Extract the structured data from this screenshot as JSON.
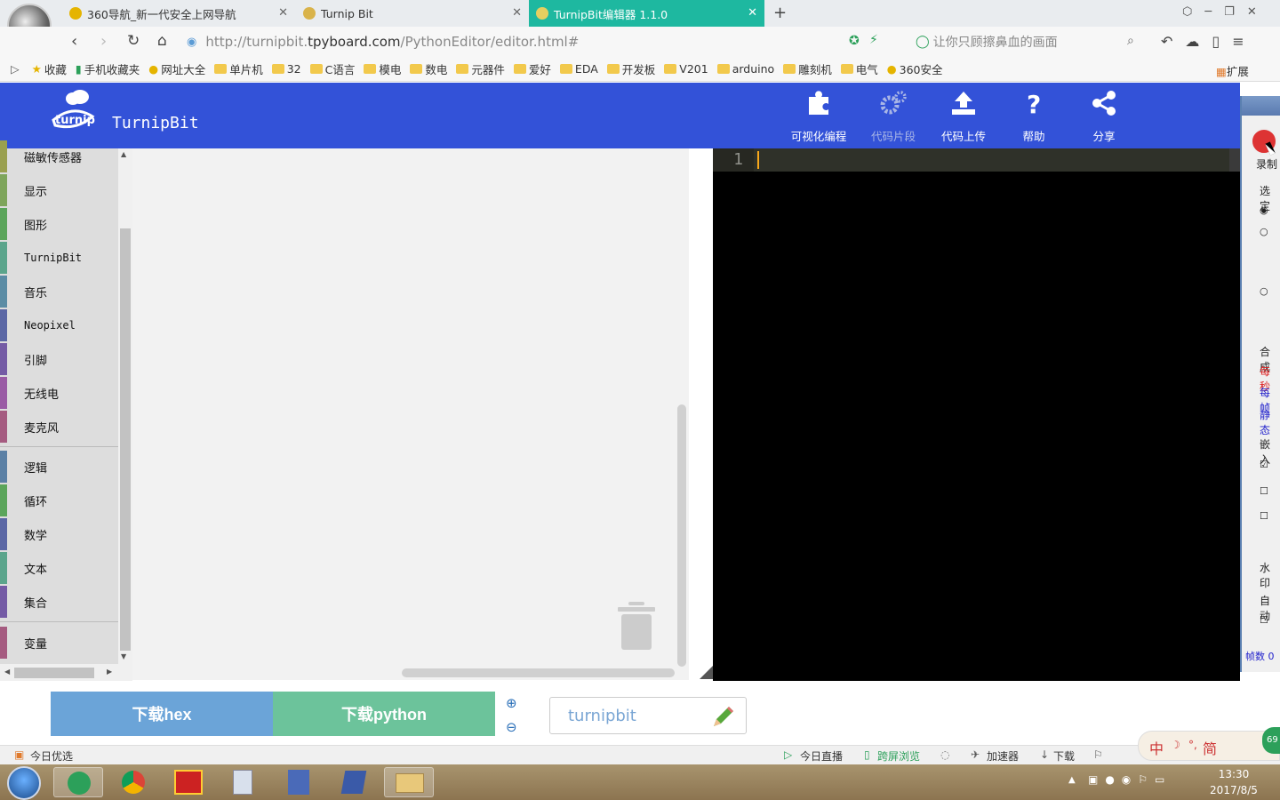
{
  "browser": {
    "tabs": [
      {
        "title": "360导航_新一代安全上网导航"
      },
      {
        "title": "Turnip Bit"
      },
      {
        "title": "TurnipBit编辑器 1.1.0"
      }
    ],
    "new_tab": "+",
    "url_prefix": "http://turnipbit.",
    "url_domain": "tpyboard.com",
    "url_path": "/PythonEditor/editor.html#",
    "search_placeholder": "让你只顾擦鼻血的画面",
    "bookmarks": [
      "收藏",
      "手机收藏夹",
      "网址大全",
      "单片机",
      "32",
      "C语言",
      "模电",
      "数电",
      "元器件",
      "爱好",
      "EDA",
      "开发板",
      "V201",
      "arduino",
      "雕刻机",
      "电气",
      "360安全"
    ],
    "extensions": "扩展"
  },
  "app": {
    "brand": "TurnipBit",
    "header_buttons": [
      {
        "label": "可视化编程",
        "icon": "puzzle-icon"
      },
      {
        "label": "代码片段",
        "icon": "gears-icon"
      },
      {
        "label": "代码上传",
        "icon": "upload-icon"
      },
      {
        "label": "帮助",
        "icon": "question-icon"
      },
      {
        "label": "分享",
        "icon": "share-icon"
      }
    ],
    "categories": [
      {
        "label": "磁敏传感器",
        "color": "#9aa04f"
      },
      {
        "label": "显示",
        "color": "#7ea55b"
      },
      {
        "label": "图形",
        "color": "#5ba55b"
      },
      {
        "label": "TurnipBit",
        "color": "#5ba58c"
      },
      {
        "label": "音乐",
        "color": "#5b8ca5"
      },
      {
        "label": "Neopixel",
        "color": "#5b67a5"
      },
      {
        "label": "引脚",
        "color": "#745ba5"
      },
      {
        "label": "无线电",
        "color": "#9a5ba5"
      },
      {
        "label": "麦克风",
        "color": "#a55b80"
      },
      {
        "label": "逻辑",
        "color": "#5b80a5"
      },
      {
        "label": "循环",
        "color": "#5ba55b"
      },
      {
        "label": "数学",
        "color": "#5b67a5"
      },
      {
        "label": "文本",
        "color": "#5ba58c"
      },
      {
        "label": "集合",
        "color": "#745ba5"
      },
      {
        "label": "变量",
        "color": "#a55b80"
      }
    ],
    "editor": {
      "line_number": "1"
    },
    "download_hex": "下载hex",
    "download_python": "下载python",
    "project_name": "turnipbit"
  },
  "status": {
    "left": "今日优选",
    "items": [
      "今日直播",
      "跨屏浏览",
      "加速器",
      "下载"
    ]
  },
  "side_panel": {
    "items": [
      "录制",
      "选定",
      "合成",
      "每秒",
      "每帧",
      "静态",
      "嵌入",
      "水印",
      "自动",
      "帧数 0"
    ]
  },
  "taskbar": {
    "time": "13:30",
    "date": "2017/8/5",
    "ime": "中",
    "ime2": "简",
    "badge": "69"
  }
}
